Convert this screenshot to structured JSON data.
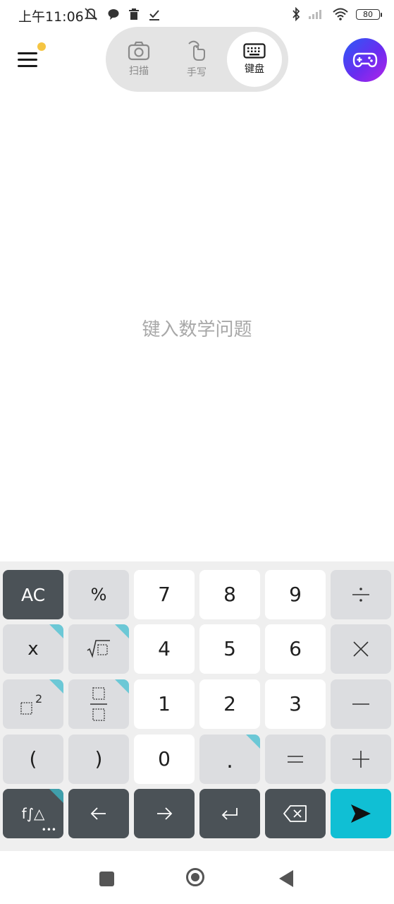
{
  "status_bar": {
    "time": "上午11:06",
    "battery": "80"
  },
  "modes": [
    {
      "label": "扫描",
      "icon": "camera-icon"
    },
    {
      "label": "手写",
      "icon": "handwriting-icon"
    },
    {
      "label": "键盘",
      "icon": "keyboard-icon",
      "active": true
    }
  ],
  "input": {
    "placeholder": "键入数学问题"
  },
  "keypad": {
    "ac": "AC",
    "percent": "%",
    "seven": "7",
    "eight": "8",
    "nine": "9",
    "x": "x",
    "four": "4",
    "five": "5",
    "six": "6",
    "one": "1",
    "two": "2",
    "three": "3",
    "open_paren": "(",
    "close_paren": ")",
    "zero": "0",
    "dot": ".",
    "functions": "f∫△"
  },
  "colors": {
    "accent": "#10bfd4",
    "dark_key": "#4b5257",
    "light_key": "#dcdde0",
    "notification_dot": "#f5c542"
  }
}
